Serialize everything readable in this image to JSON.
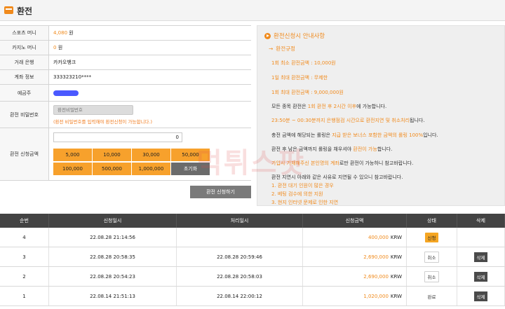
{
  "header": {
    "title": "환전"
  },
  "form": {
    "rows": [
      {
        "label": "스포츠 머니",
        "value": "4,080",
        "unit": "원"
      },
      {
        "label": "카지노 머니",
        "value": "0",
        "unit": "원"
      },
      {
        "label": "거래 은행",
        "value": "카카오뱅크"
      },
      {
        "label": "계좌 정보",
        "value": "333323210****"
      },
      {
        "label": "예금주"
      }
    ],
    "password": {
      "label": "환전 비밀번호",
      "placeholder": "환전비밀번호",
      "note": "(환전 비밀번호를 입력해야 환전신청이 가능합니다.)"
    },
    "amount": {
      "label": "환전 신청금액",
      "value": "0",
      "buttons": [
        "5,000",
        "10,000",
        "30,000",
        "50,000",
        "100,000",
        "500,000",
        "1,000,000"
      ],
      "reset": "초기화"
    },
    "submit": "환전 신청하기"
  },
  "notice": {
    "title": "환전신청시 안내사항",
    "subtitle": "환전규정",
    "rules": [
      "1회 최소 환전금액 : 10,000원",
      "1일 최대 환전금액 : 무제한",
      "1회 최대 환전금액 : 9,000,000원"
    ],
    "l1a": "모든 종목 환전은 ",
    "l1b": "1회 환전 후 2시간 이후",
    "l1c": "에 가능합니다.",
    "l2a": "23:50분 ~ 00:30분까지 은행점검 시간으로 환전지연 및 취소처리",
    "l2b": "됩니다.",
    "l3a": "충전 금액에 해당되는 롤링은 ",
    "l3b": "지급 받은 보너스 포함한 금액의 롤링 100%",
    "l3c": "입니다.",
    "l4a": "환전 후 남은 금액까지 롤링을 채우셔야 ",
    "l4b": "환전이 가능",
    "l4c": "합니다.",
    "l5a": "가입시 기재해주신 본인명의 계좌",
    "l5b": "로만 환전이 가능하니 참고바랍니다.",
    "l6": "환전 지연시 아래와 같은 사유로 지연될 수 있으니 참고바랍니다.",
    "reasons": [
      "1. 환전 대기 인원이 많은 경우",
      "2. 베팅 검수에 의한 지원",
      "3. 현지 인터넷 문제로 인한 지연"
    ]
  },
  "watermark": "먹튀스팟",
  "history": {
    "headers": [
      "순번",
      "신청일시",
      "처리일시",
      "신청금액",
      "상태",
      "삭제"
    ],
    "currency": "KRW",
    "rows": [
      {
        "no": "4",
        "requested": "22.08.28 21:14:56",
        "processed": "",
        "amount": "400,000",
        "status": "신청",
        "delete": ""
      },
      {
        "no": "3",
        "requested": "22.08.28 20:58:35",
        "processed": "22.08.28 20:59:46",
        "amount": "2,690,000",
        "status": "취소",
        "delete": "삭제"
      },
      {
        "no": "2",
        "requested": "22.08.28 20:54:23",
        "processed": "22.08.28 20:58:03",
        "amount": "2,690,000",
        "status": "취소",
        "delete": "삭제"
      },
      {
        "no": "1",
        "requested": "22.08.14 21:51:13",
        "processed": "22.08.14 22:00:12",
        "amount": "1,020,000",
        "status": "완료",
        "delete": "삭제"
      }
    ]
  }
}
